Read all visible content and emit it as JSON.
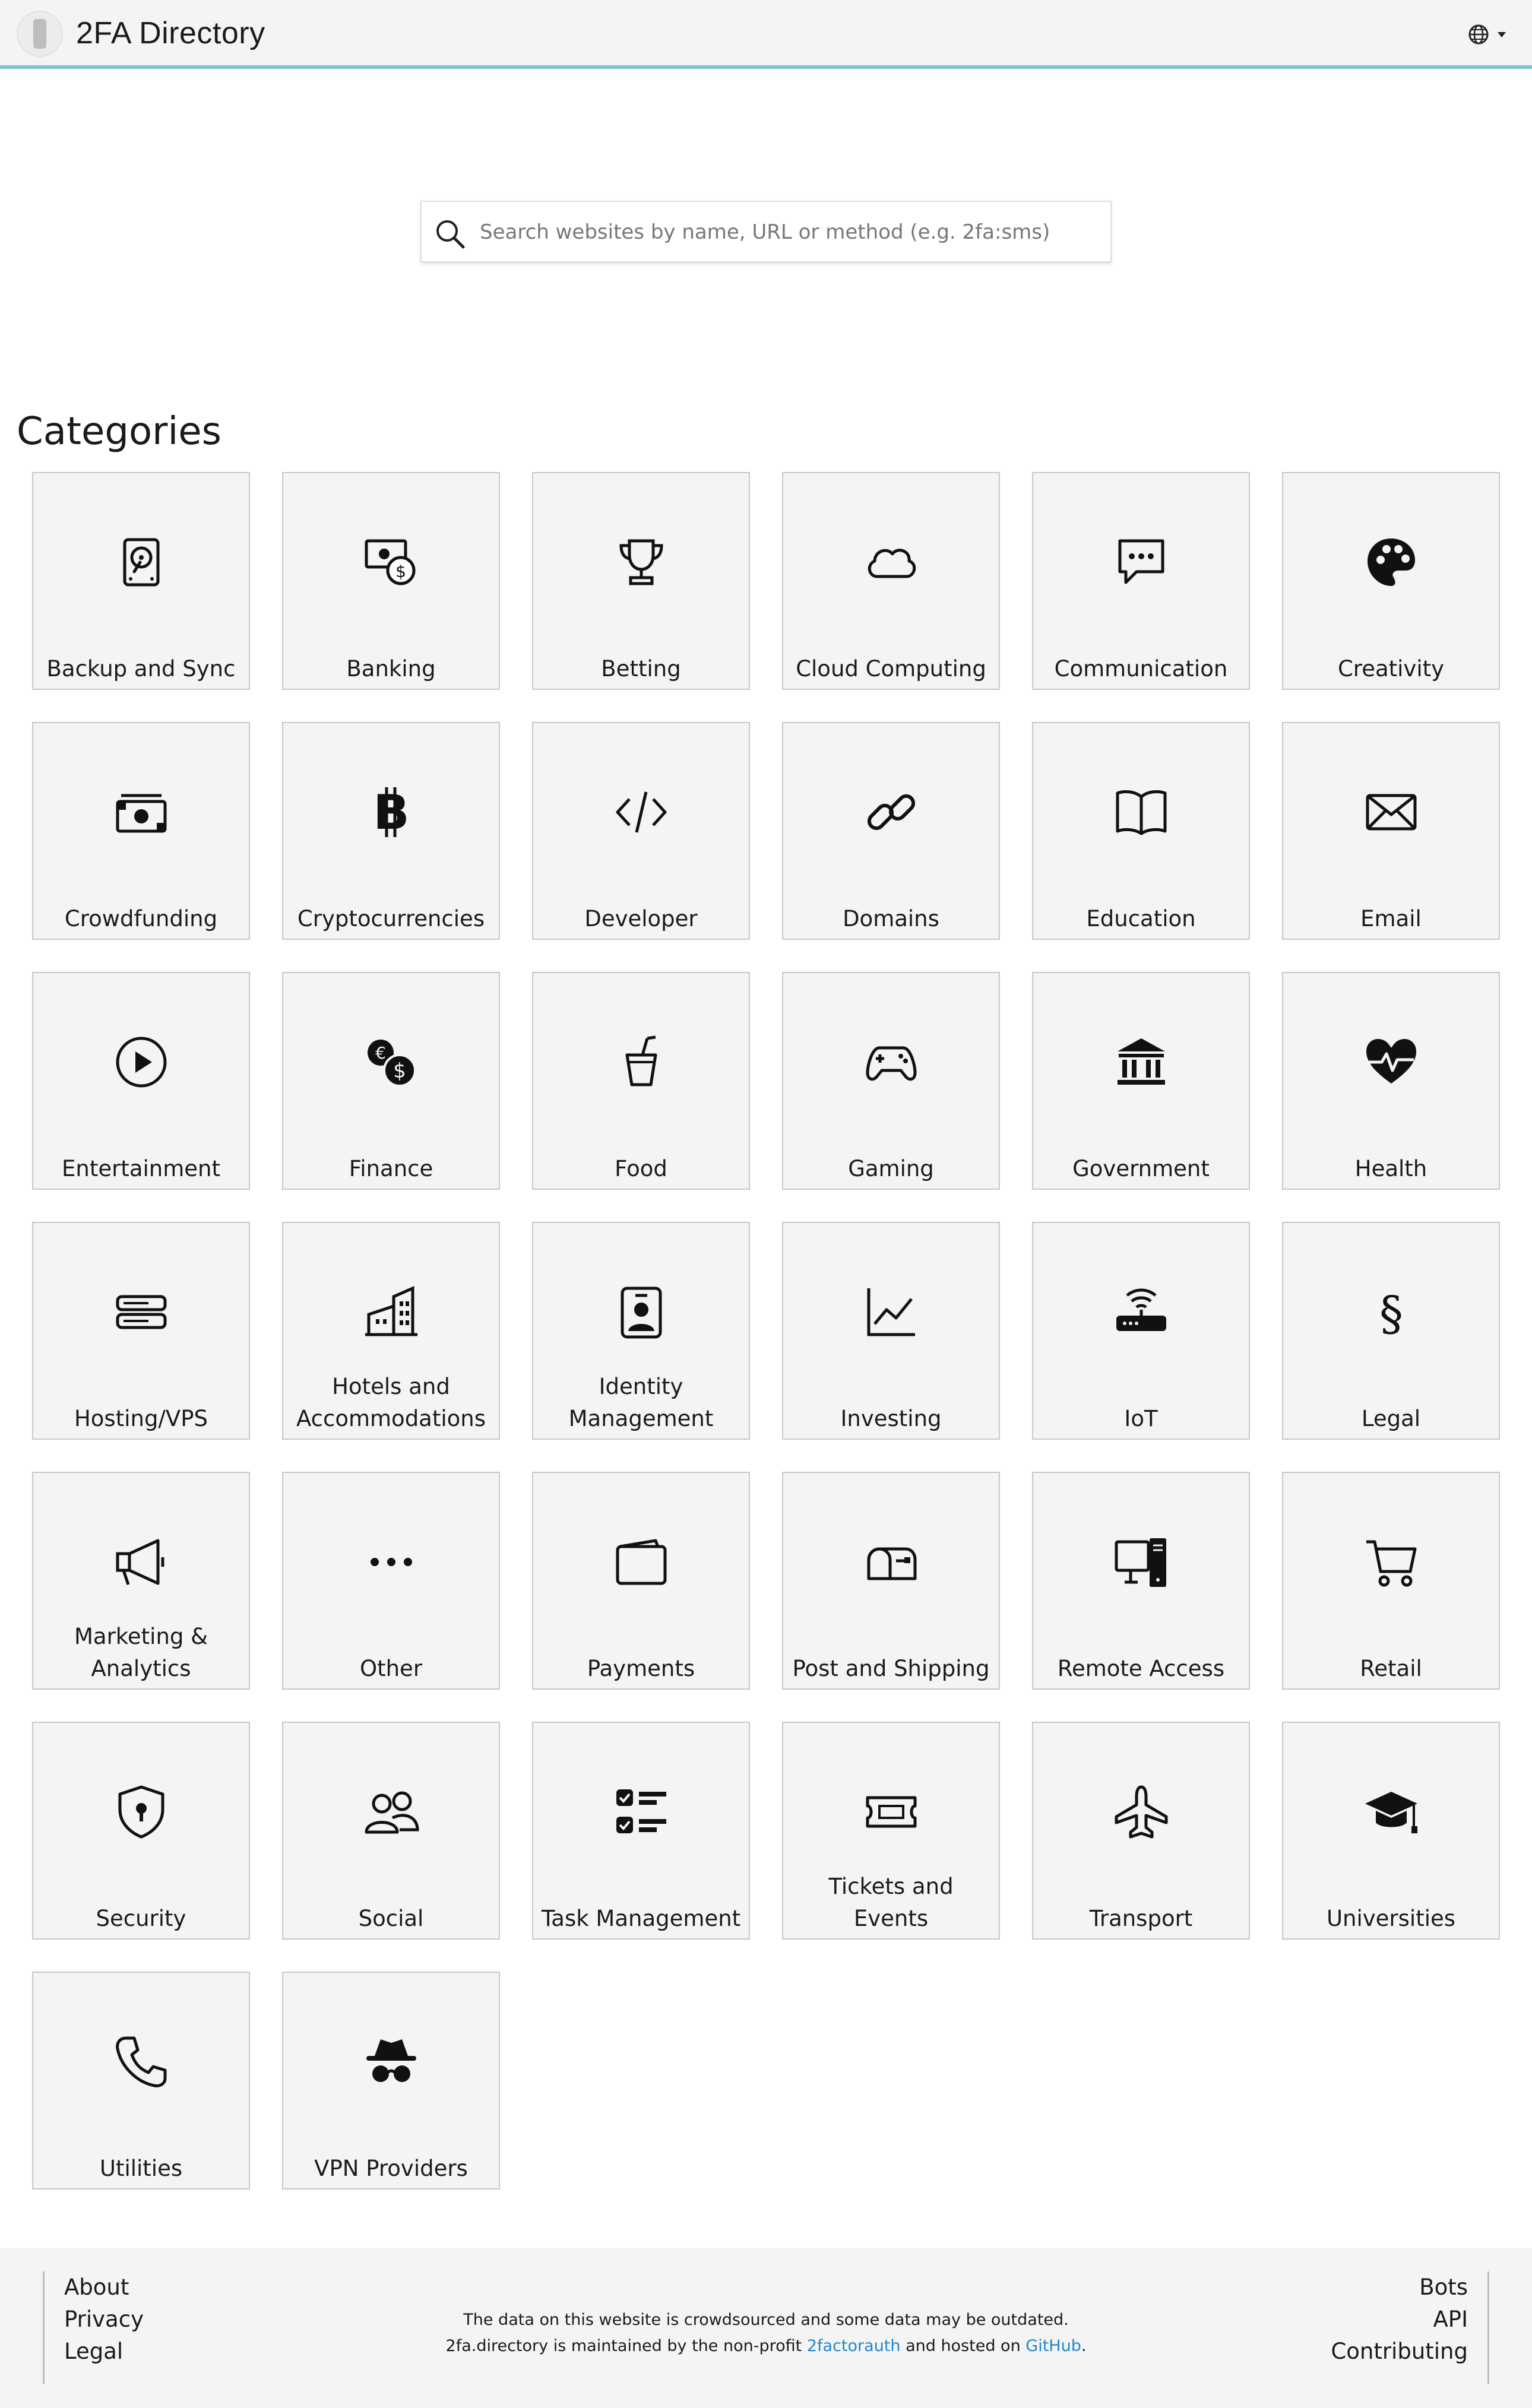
{
  "header": {
    "title": "2FA Directory",
    "logo_icon": "phone-key-icon",
    "language_icon": "globe-icon"
  },
  "search": {
    "placeholder": "Search websites by name, URL or method (e.g. 2fa:sms)",
    "value": ""
  },
  "categories": {
    "heading": "Categories",
    "items": [
      {
        "label": "Backup and Sync",
        "icon": "hard-drive-icon"
      },
      {
        "label": "Banking",
        "icon": "cash-coin-icon"
      },
      {
        "label": "Betting",
        "icon": "trophy-icon"
      },
      {
        "label": "Cloud Computing",
        "icon": "cloud-icon"
      },
      {
        "label": "Communication",
        "icon": "chat-dots-icon"
      },
      {
        "label": "Creativity",
        "icon": "palette-icon"
      },
      {
        "label": "Crowdfunding",
        "icon": "cash-stack-icon"
      },
      {
        "label": "Cryptocurrencies",
        "icon": "bitcoin-icon"
      },
      {
        "label": "Developer",
        "icon": "code-slash-icon"
      },
      {
        "label": "Domains",
        "icon": "link-icon"
      },
      {
        "label": "Education",
        "icon": "book-icon"
      },
      {
        "label": "Email",
        "icon": "envelope-icon"
      },
      {
        "label": "Entertainment",
        "icon": "play-circle-icon"
      },
      {
        "label": "Finance",
        "icon": "currency-exchange-icon"
      },
      {
        "label": "Food",
        "icon": "cup-straw-icon"
      },
      {
        "label": "Gaming",
        "icon": "controller-icon"
      },
      {
        "label": "Government",
        "icon": "bank-icon"
      },
      {
        "label": "Health",
        "icon": "heart-pulse-icon"
      },
      {
        "label": "Hosting/VPS",
        "icon": "server-icon"
      },
      {
        "label": "Hotels and Accommodations",
        "icon": "buildings-icon"
      },
      {
        "label": "Identity Management",
        "icon": "person-badge-icon"
      },
      {
        "label": "Investing",
        "icon": "graph-up-icon"
      },
      {
        "label": "IoT",
        "icon": "router-icon"
      },
      {
        "label": "Legal",
        "icon": "section-sign-icon"
      },
      {
        "label": "Marketing & Analytics",
        "icon": "megaphone-icon"
      },
      {
        "label": "Other",
        "icon": "three-dots-icon"
      },
      {
        "label": "Payments",
        "icon": "wallet-icon"
      },
      {
        "label": "Post and Shipping",
        "icon": "mailbox-icon"
      },
      {
        "label": "Remote Access",
        "icon": "pc-display-icon"
      },
      {
        "label": "Retail",
        "icon": "cart-icon"
      },
      {
        "label": "Security",
        "icon": "shield-lock-icon"
      },
      {
        "label": "Social",
        "icon": "people-icon"
      },
      {
        "label": "Task Management",
        "icon": "ui-checks-icon"
      },
      {
        "label": "Tickets and Events",
        "icon": "ticket-icon"
      },
      {
        "label": "Transport",
        "icon": "airplane-icon"
      },
      {
        "label": "Universities",
        "icon": "mortarboard-icon"
      },
      {
        "label": "Utilities",
        "icon": "telephone-icon"
      },
      {
        "label": "VPN Providers",
        "icon": "incognito-icon"
      }
    ]
  },
  "footer": {
    "left_links": [
      "About",
      "Privacy",
      "Legal"
    ],
    "right_links": [
      "Bots",
      "API",
      "Contributing"
    ],
    "disclaimer": "The data on this website is crowdsourced and some data may be outdated.",
    "maintained_prefix": "2fa.directory is maintained by the non-profit",
    "org_link": "2factorauth",
    "hosted_text": "and hosted on",
    "github_link": "GitHub",
    "period": ".",
    "link_color": "#1e88c8"
  }
}
